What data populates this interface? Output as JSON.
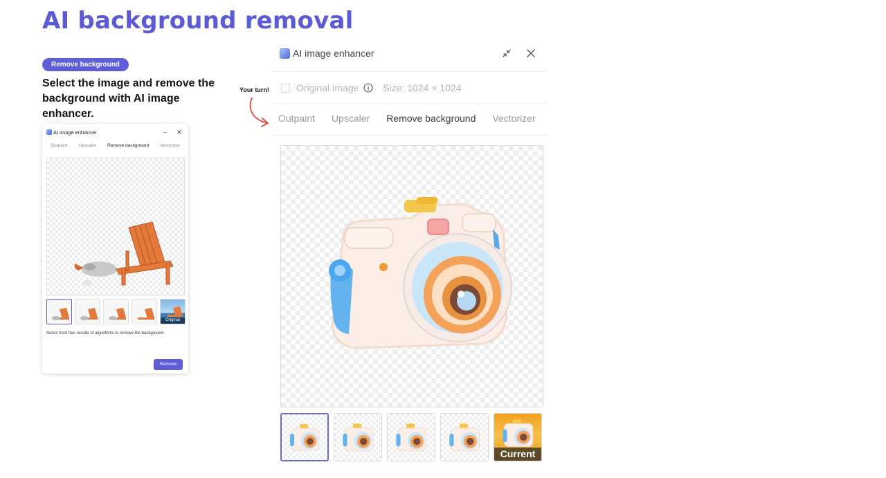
{
  "page": {
    "title": "AI background removal",
    "pill": "Remove background",
    "description": "Select the image and remove the background with AI image enhancer."
  },
  "mini_dialog": {
    "title": "AI image enhancer",
    "minimize": "–",
    "close": "✕",
    "tabs": [
      {
        "label": "Outpaint",
        "active": false
      },
      {
        "label": "Upscaler",
        "active": false
      },
      {
        "label": "Remove background",
        "active": true
      },
      {
        "label": "Vectorizer",
        "active": false
      }
    ],
    "original_label": "Original",
    "hint": "Select from four results of algorithms to remove the background.",
    "remove_label": "Remove"
  },
  "annotation": {
    "text": "Your turn!",
    "arrow_color": "#e0453a"
  },
  "dialog": {
    "title": "AI image enhancer",
    "original_image_label": "Original image",
    "original_image_checked": false,
    "size_label": "Size: 1024 × 1024",
    "tabs": [
      {
        "label": "Outpaint",
        "active": false
      },
      {
        "label": "Upscaler",
        "active": false
      },
      {
        "label": "Remove background",
        "active": true
      },
      {
        "label": "Vectorizer",
        "active": false
      }
    ],
    "current_label": "Current",
    "selected_result": 1
  },
  "colors": {
    "accent": "#5f5ed9",
    "title": "#5c5bd6"
  }
}
